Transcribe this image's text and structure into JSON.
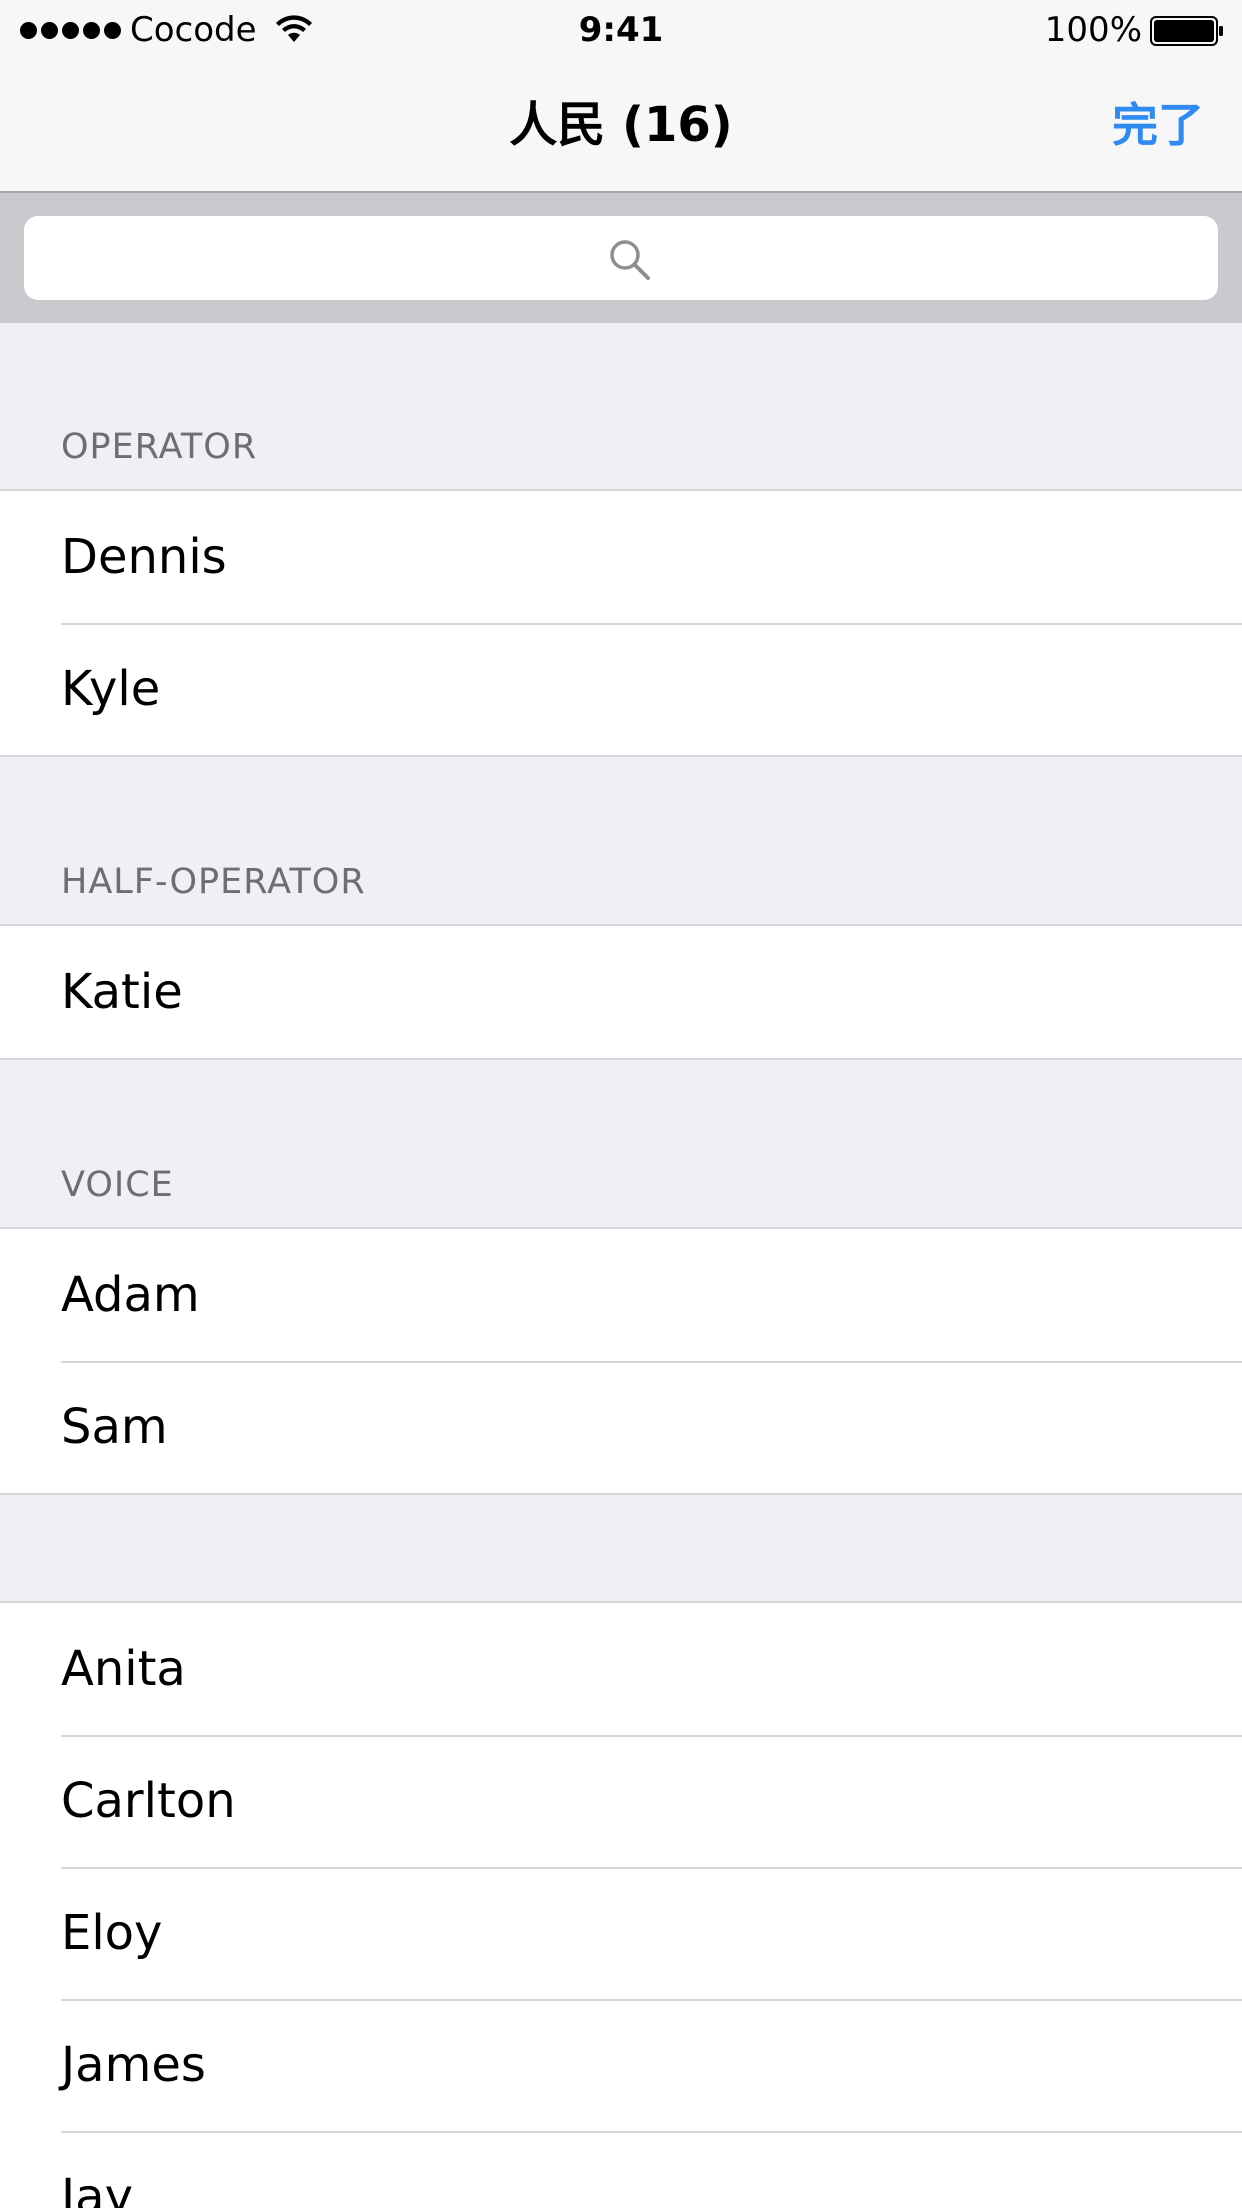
{
  "status_bar": {
    "carrier": "Cocode",
    "time": "9:41",
    "battery": "100%"
  },
  "nav": {
    "title": "人民 (16)",
    "done_label": "完了"
  },
  "search": {
    "placeholder": "",
    "value": ""
  },
  "sections": [
    {
      "header": "OPERATOR",
      "members": [
        "Dennis",
        "Kyle"
      ]
    },
    {
      "header": "HALF-OPERATOR",
      "members": [
        "Katie"
      ]
    },
    {
      "header": "VOICE",
      "members": [
        "Adam",
        "Sam"
      ]
    },
    {
      "header": "",
      "members": [
        "Anita",
        "Carlton",
        "Eloy",
        "James",
        "Jay"
      ]
    }
  ],
  "colors": {
    "accent": "#2f8bf1",
    "background": "#efeff4",
    "separator": "#d6d6da",
    "header_text": "#6d6d72"
  }
}
